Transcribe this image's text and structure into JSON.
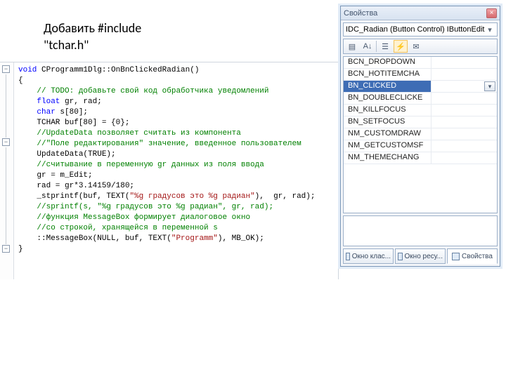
{
  "annotation": {
    "line1": "Добавить  #include",
    "line2": "\"tchar.h\""
  },
  "code": {
    "t_void": "void",
    "sig_rest": " CProgramm1Dlg::OnBnClickedRadian()",
    "brace_open": "{",
    "cm_todo": "// TODO: добавьте свой код обработчика уведомлений",
    "t_float": "float",
    "decl_float_rest": " gr, rad;",
    "t_char": "char",
    "decl_char_rest": " s[80];",
    "tchar_line": "TCHAR buf[80] = {0};",
    "cm_upd1": "//UpdateData позволяет считать из компонента",
    "cm_upd2": "//\"Поле редактирования\" значение, введенное пользователем",
    "call_upd": "UpdateData(TRUE);",
    "cm_read": "//считывание в переменную gr данных из поля ввода",
    "assign_gr": "gr = m_Edit;",
    "assign_rad": "rad = gr*3.14159/180;",
    "sprintf_a": "_stprintf(buf, TEXT(",
    "str_fmt": "\"%g градусов это %g радиан\"",
    "sprintf_b": "),  gr, rad);",
    "cm_sprintf": "//sprintf(s, \"%g градусов это %g радиан\", gr, rad);",
    "cm_mb1": "//функция MessageBox формирует диалоговое окно",
    "cm_mb2": "//со строкой, хранящейся в переменной s",
    "mb_a": "::MessageBox(NULL, buf, TEXT(",
    "str_prog": "\"Programm\"",
    "mb_b": "), MB_OK);",
    "brace_close": "}"
  },
  "gutter": {
    "minus": "−"
  },
  "props": {
    "title": "Свойства",
    "combo": "IDC_Radian (Button Control) IButtonEditor",
    "events": [
      "BCN_DROPDOWN",
      "BCN_HOTITEMCHA",
      "BN_CLICKED",
      "BN_DOUBLECLICKE",
      "BN_KILLFOCUS",
      "BN_SETFOCUS",
      "NM_CUSTOMDRAW",
      "NM_GETCUSTOMSF",
      "NM_THEMECHANG"
    ],
    "selected_index": 2,
    "tabs": {
      "a": "Окно клас...",
      "b": "Окно ресу...",
      "c": "Свойства"
    },
    "toolbar_icons": {
      "cat": "▤",
      "sort": "A↓",
      "props": "☰",
      "events": "⚡",
      "msgs": "✉"
    }
  }
}
